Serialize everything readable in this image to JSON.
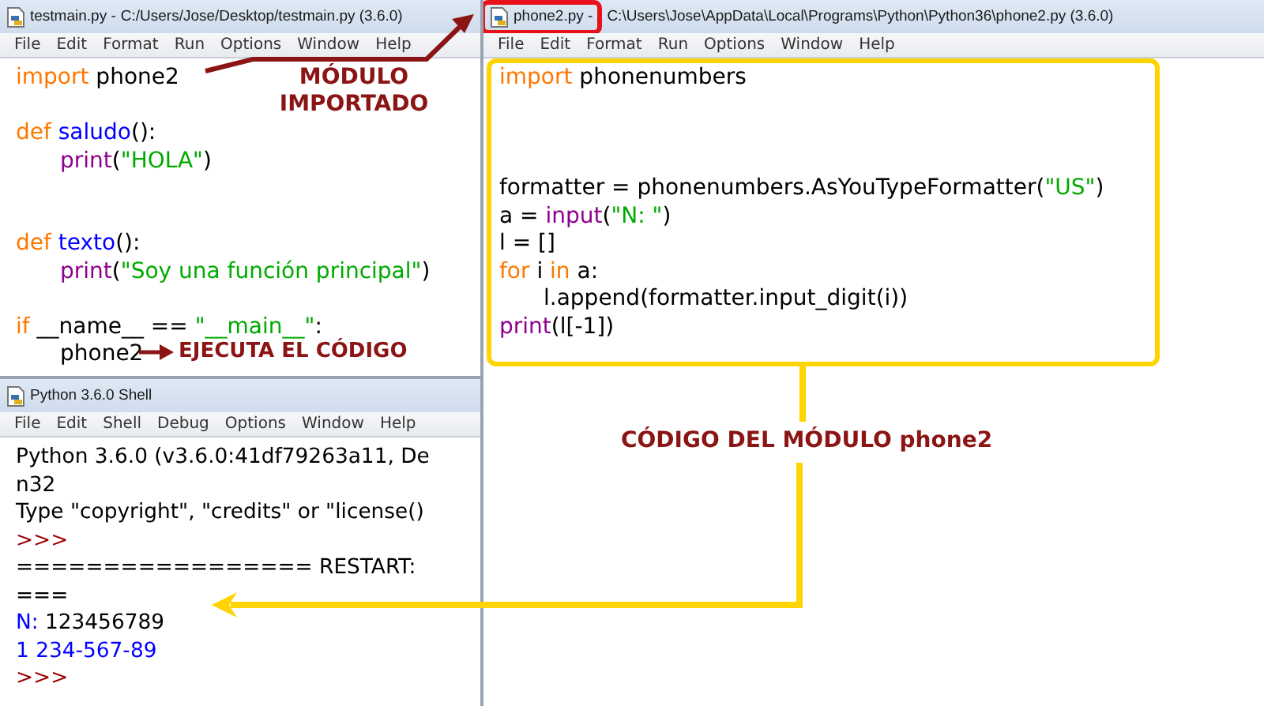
{
  "windows": [
    {
      "kind": "editor",
      "title_parts": [
        {
          "text": "testmain.py -",
          "highlighted": false
        },
        {
          "text": "C:/Users/Jose/Desktop/testmain.py (3.6.0)",
          "highlighted": false
        }
      ],
      "menu": [
        "File",
        "Edit",
        "Format",
        "Run",
        "Options",
        "Window",
        "Help"
      ],
      "lines": [
        {
          "kind": "code",
          "indented": false,
          "tokens": [
            {
              "kind": "keyword",
              "text": "import"
            },
            {
              "kind": "plain",
              "text": " phone2"
            }
          ]
        },
        {
          "kind": "blank"
        },
        {
          "kind": "code",
          "indented": false,
          "tokens": [
            {
              "kind": "keyword",
              "text": "def"
            },
            {
              "kind": "defname",
              "text": " saludo"
            },
            {
              "kind": "plain",
              "text": "():"
            }
          ]
        },
        {
          "kind": "code",
          "indented": true,
          "tokens": [
            {
              "kind": "builtin",
              "text": "print"
            },
            {
              "kind": "plain",
              "text": "("
            },
            {
              "kind": "string",
              "text": "\"HOLA\""
            },
            {
              "kind": "plain",
              "text": ")"
            }
          ]
        },
        {
          "kind": "blank"
        },
        {
          "kind": "blank"
        },
        {
          "kind": "code",
          "indented": false,
          "tokens": [
            {
              "kind": "keyword",
              "text": "def"
            },
            {
              "kind": "defname",
              "text": " texto"
            },
            {
              "kind": "plain",
              "text": "():"
            }
          ]
        },
        {
          "kind": "code",
          "indented": true,
          "tokens": [
            {
              "kind": "builtin",
              "text": "print"
            },
            {
              "kind": "plain",
              "text": "("
            },
            {
              "kind": "string",
              "text": "\"Soy una función principal\""
            },
            {
              "kind": "plain",
              "text": ")"
            }
          ]
        },
        {
          "kind": "blank"
        },
        {
          "kind": "code",
          "indented": false,
          "tokens": [
            {
              "kind": "keyword",
              "text": "if"
            },
            {
              "kind": "plain",
              "text": " __name__ == "
            },
            {
              "kind": "string",
              "text": "\"__main__\""
            },
            {
              "kind": "plain",
              "text": ":"
            }
          ]
        },
        {
          "kind": "code",
          "indented": true,
          "tokens": [
            {
              "kind": "plain",
              "text": "phone2"
            }
          ]
        }
      ]
    },
    {
      "kind": "shell",
      "title_parts": [
        {
          "text": "Python 3.6.0 Shell",
          "highlighted": false
        }
      ],
      "menu": [
        "File",
        "Edit",
        "Shell",
        "Debug",
        "Options",
        "Window",
        "Help"
      ],
      "lines": [
        {
          "kind": "code",
          "indented": false,
          "tokens": [
            {
              "kind": "plain",
              "text": "Python 3.6.0 (v3.6.0:41df79263a11, De"
            }
          ]
        },
        {
          "kind": "code",
          "indented": false,
          "tokens": [
            {
              "kind": "plain",
              "text": "n32"
            }
          ]
        },
        {
          "kind": "code",
          "indented": false,
          "tokens": [
            {
              "kind": "plain",
              "text": "Type \"copyright\", \"credits\" or \"license()"
            }
          ]
        },
        {
          "kind": "code",
          "indented": false,
          "tokens": [
            {
              "kind": "prompt",
              "text": ">>>"
            }
          ]
        },
        {
          "kind": "code",
          "indented": false,
          "tokens": [
            {
              "kind": "plain",
              "text": "================= RESTART:"
            }
          ]
        },
        {
          "kind": "code",
          "indented": false,
          "tokens": [
            {
              "kind": "plain",
              "text": "==="
            }
          ]
        },
        {
          "kind": "code",
          "indented": false,
          "tokens": [
            {
              "kind": "output",
              "text": "N: "
            },
            {
              "kind": "plain",
              "text": "123456789"
            }
          ]
        },
        {
          "kind": "code",
          "indented": false,
          "tokens": [
            {
              "kind": "output",
              "text": "1 234-567-89"
            }
          ]
        },
        {
          "kind": "code",
          "indented": false,
          "tokens": [
            {
              "kind": "prompt",
              "text": ">>>"
            }
          ]
        }
      ]
    },
    {
      "kind": "editor",
      "title_parts": [
        {
          "text": "phone2.py -",
          "highlighted": true
        },
        {
          "text": "C:\\Users\\Jose\\AppData\\Local\\Programs\\Python\\Python36\\phone2.py (3.6.0)",
          "highlighted": false
        }
      ],
      "menu": [
        "File",
        "Edit",
        "Format",
        "Run",
        "Options",
        "Window",
        "Help"
      ],
      "lines": [
        {
          "kind": "code",
          "indented": false,
          "tokens": [
            {
              "kind": "keyword",
              "text": "import"
            },
            {
              "kind": "plain",
              "text": " phonenumbers"
            }
          ]
        },
        {
          "kind": "blank"
        },
        {
          "kind": "blank"
        },
        {
          "kind": "blank"
        },
        {
          "kind": "code",
          "indented": false,
          "tokens": [
            {
              "kind": "plain",
              "text": "formatter = phonenumbers.AsYouTypeFormatter("
            },
            {
              "kind": "string",
              "text": "\"US\""
            },
            {
              "kind": "plain",
              "text": ")"
            }
          ]
        },
        {
          "kind": "code",
          "indented": false,
          "tokens": [
            {
              "kind": "plain",
              "text": "a = "
            },
            {
              "kind": "builtin",
              "text": "input"
            },
            {
              "kind": "plain",
              "text": "("
            },
            {
              "kind": "string",
              "text": "\"N: \""
            },
            {
              "kind": "plain",
              "text": ")"
            }
          ]
        },
        {
          "kind": "code",
          "indented": false,
          "tokens": [
            {
              "kind": "plain",
              "text": "l = []"
            }
          ]
        },
        {
          "kind": "code",
          "indented": false,
          "tokens": [
            {
              "kind": "keyword",
              "text": "for"
            },
            {
              "kind": "plain",
              "text": " i "
            },
            {
              "kind": "keyword",
              "text": "in"
            },
            {
              "kind": "plain",
              "text": " a:"
            }
          ]
        },
        {
          "kind": "code",
          "indented": true,
          "tokens": [
            {
              "kind": "plain",
              "text": "l.append(formatter.input_digit(i))"
            }
          ]
        },
        {
          "kind": "code",
          "indented": false,
          "tokens": [
            {
              "kind": "builtin",
              "text": "print"
            },
            {
              "kind": "plain",
              "text": "(l[-1])"
            }
          ]
        }
      ]
    }
  ],
  "annotations": {
    "imported_label": "MÓDULO IMPORTADO",
    "runs_label": "EJECUTA EL CÓDIGO",
    "module_label": "CÓDIGO DEL MÓDULO phone2"
  }
}
